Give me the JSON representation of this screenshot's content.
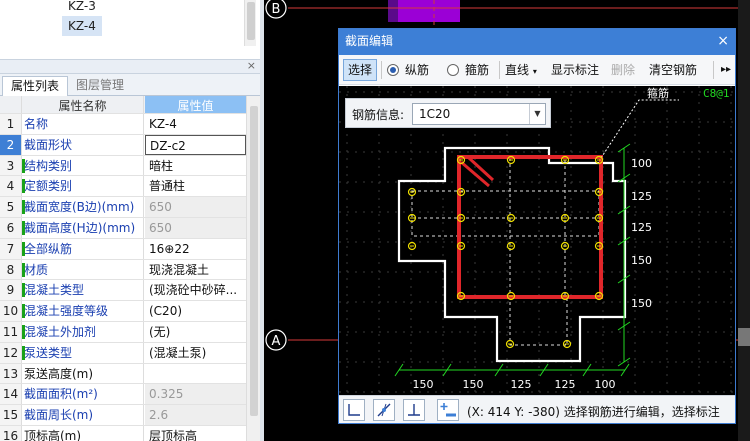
{
  "tree": {
    "items": [
      "KZ-3",
      "KZ-4"
    ]
  },
  "panel": {
    "close": "×",
    "tabs": [
      "属性列表",
      "图层管理"
    ],
    "header": {
      "name": "属性名称",
      "value": "属性值"
    },
    "rows": [
      {
        "num": "1",
        "name": "名称",
        "value": "KZ-4"
      },
      {
        "num": "2",
        "name": "截面形状",
        "value": "DZ-c2"
      },
      {
        "num": "3",
        "name": "结构类别",
        "value": "暗柱"
      },
      {
        "num": "4",
        "name": "定额类别",
        "value": "普通柱"
      },
      {
        "num": "5",
        "name": "截面宽度(B边)(mm)",
        "value": "650"
      },
      {
        "num": "6",
        "name": "截面高度(H边)(mm)",
        "value": "650"
      },
      {
        "num": "7",
        "name": "全部纵筋",
        "value": "16⊕22"
      },
      {
        "num": "8",
        "name": "材质",
        "value": "现浇混凝土"
      },
      {
        "num": "9",
        "name": "混凝土类型",
        "value": "(现浇砼中砂碎..."
      },
      {
        "num": "10",
        "name": "混凝土强度等级",
        "value": "(C20)"
      },
      {
        "num": "11",
        "name": "混凝土外加剂",
        "value": "(无)"
      },
      {
        "num": "12",
        "name": "泵送类型",
        "value": "(混凝土泵)"
      },
      {
        "num": "13",
        "name": "泵送高度(m)",
        "value": ""
      },
      {
        "num": "14",
        "name": "截面面积(m²)",
        "value": "0.325"
      },
      {
        "num": "15",
        "name": "截面周长(m)",
        "value": "2.6"
      },
      {
        "num": "16",
        "name": "顶标高(m)",
        "value": "层顶标高"
      }
    ]
  },
  "axes": {
    "top": "B",
    "bottom": "A"
  },
  "dialog": {
    "title": "截面编辑",
    "close": "×",
    "toolbar": {
      "select": "选择",
      "longitudinal": "纵筋",
      "stirrup": "箍筋",
      "line": "直线",
      "show_labels": "显示标注",
      "delete": "删除",
      "clear": "清空钢筋",
      "more": "▸▸"
    },
    "info_label": "钢筋信息:",
    "info_value": "1C20",
    "stirrup_label": "箍筋",
    "stirrup_spec": "C8@1",
    "dims_right": [
      "100",
      "125",
      "125",
      "150",
      "150"
    ],
    "dims_bottom": [
      "150",
      "150",
      "125",
      "125",
      "100"
    ],
    "status": "(X: 414 Y: -380)  选择钢筋进行编辑，选择标注"
  },
  "colors": {
    "accent": "#3d7fd6",
    "rebar": "#e0262a",
    "outline": "#ffffff",
    "dimension": "#22d822",
    "bar_point": "#f0e000"
  }
}
